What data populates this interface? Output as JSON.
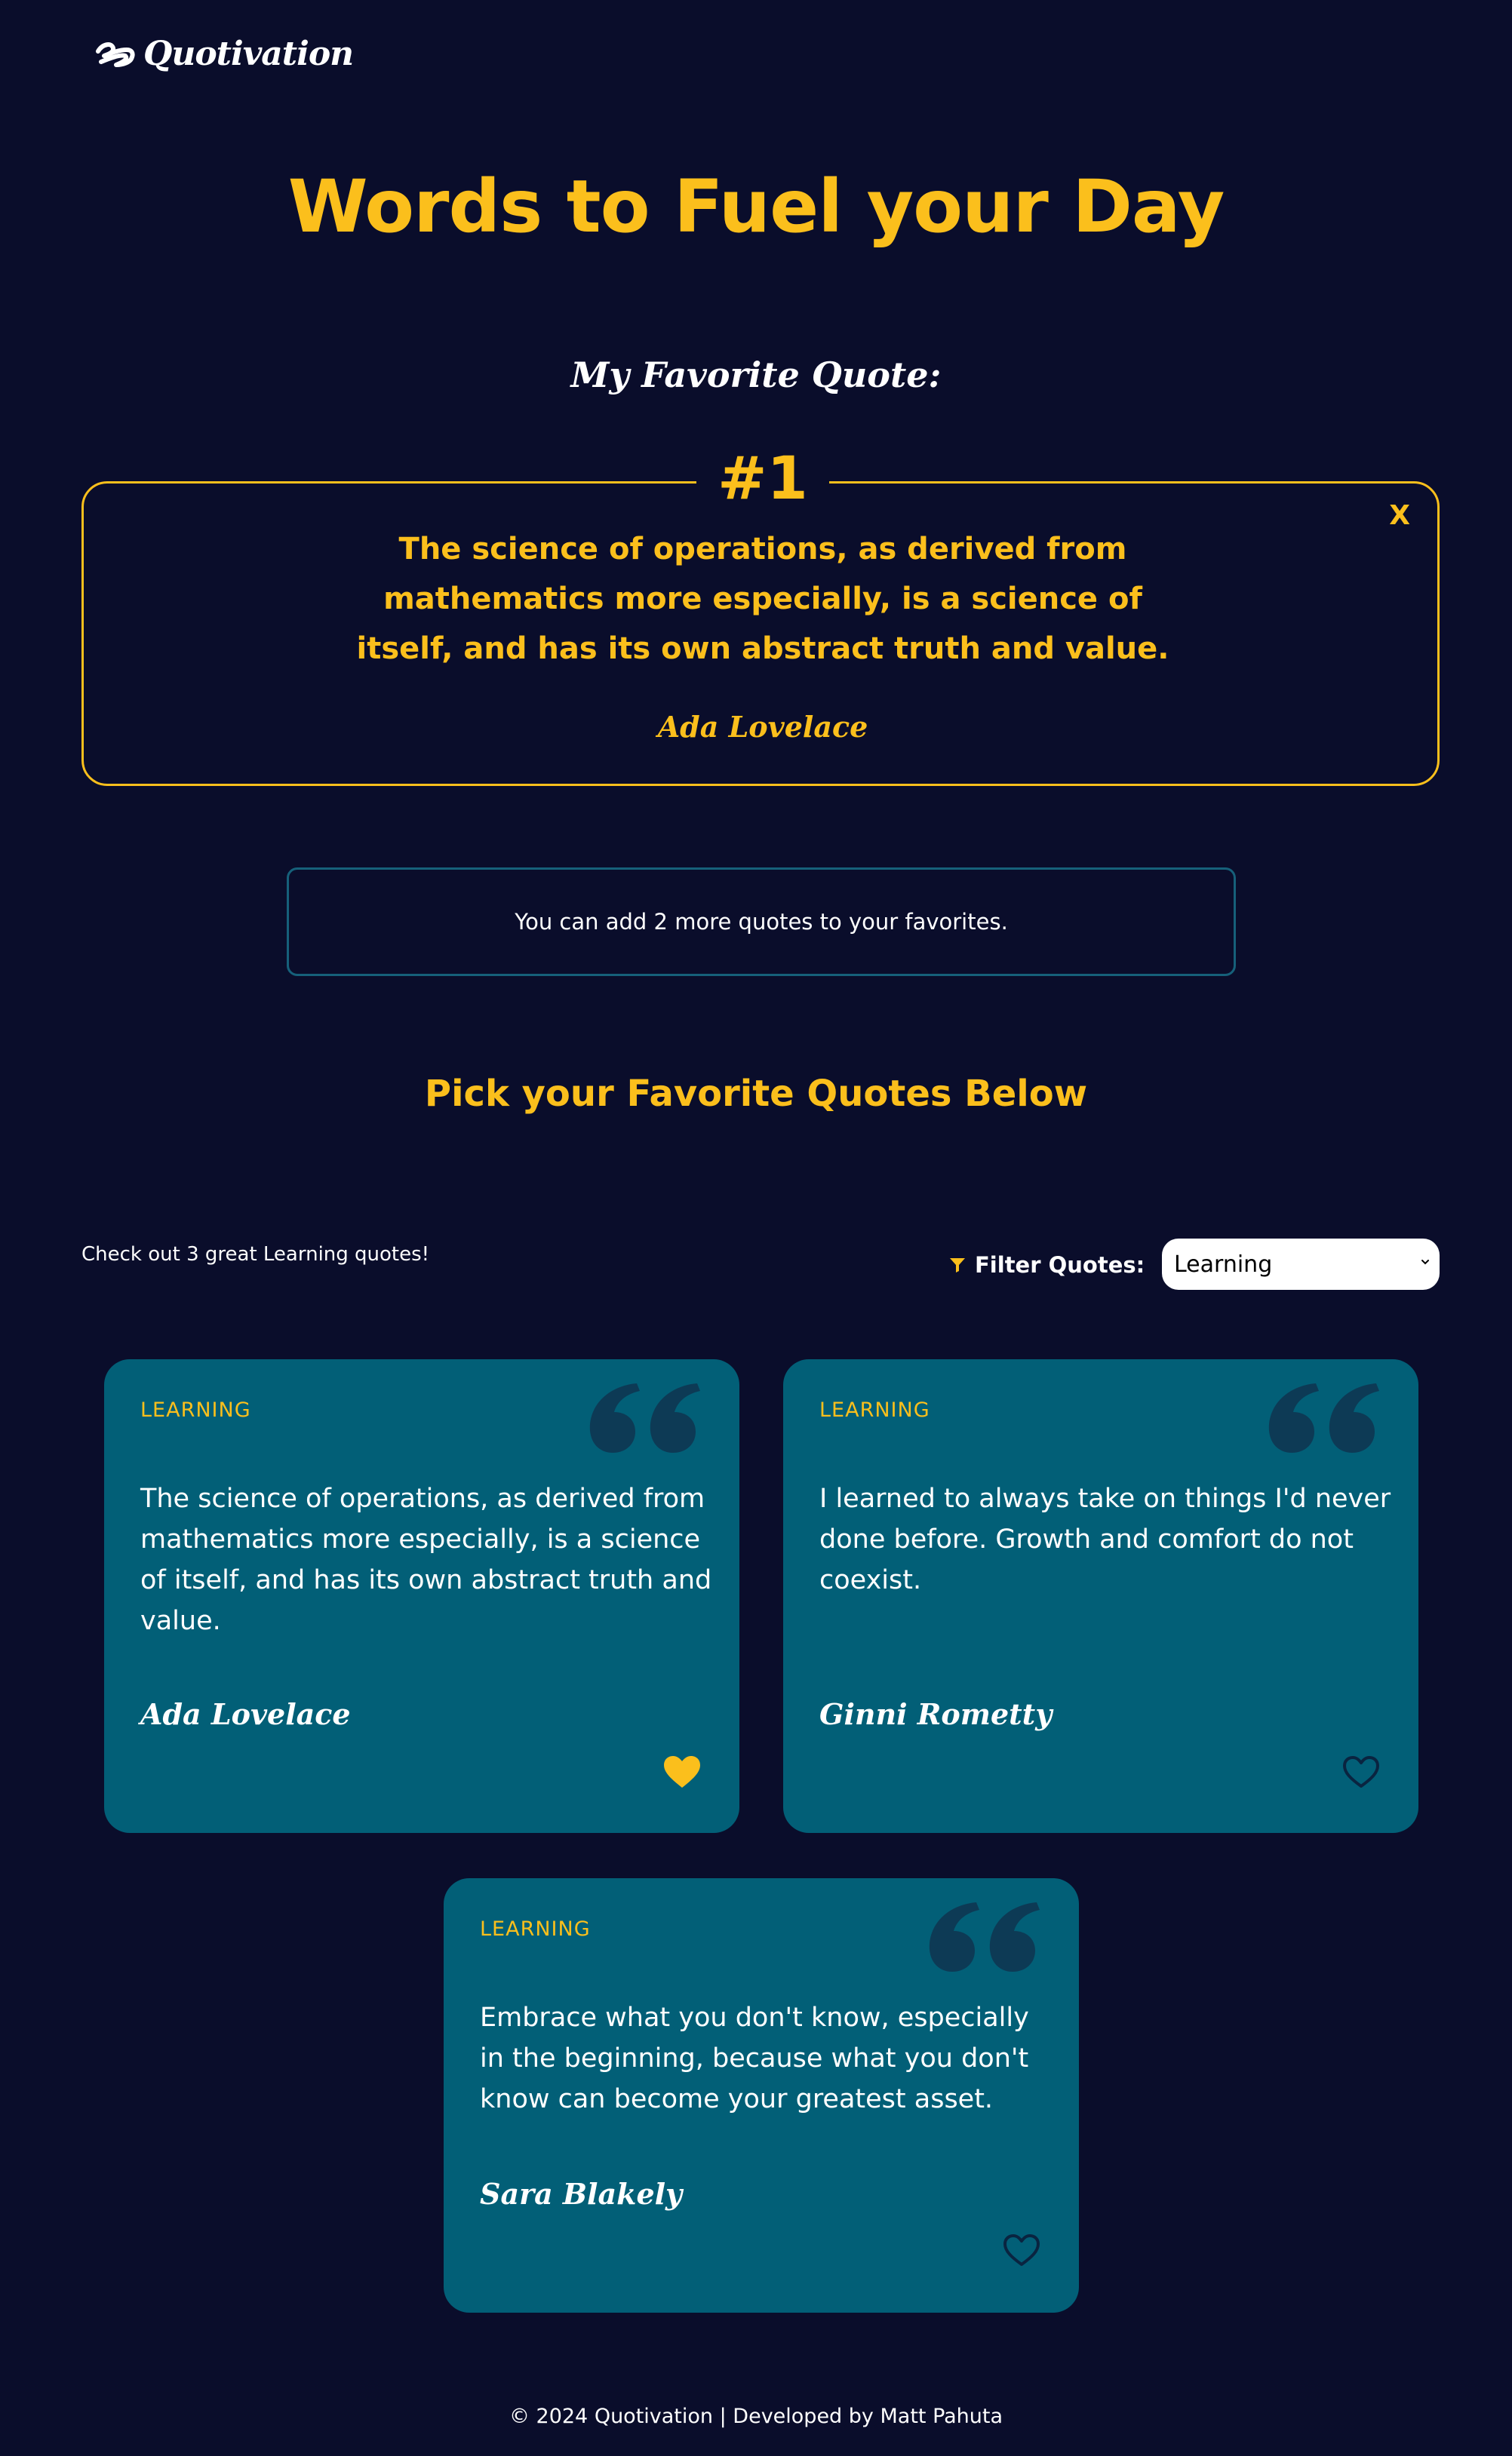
{
  "brand": {
    "name": "Quotivation"
  },
  "hero": {
    "title": "Words to Fuel your Day"
  },
  "favorites": {
    "heading": "My Favorite Quote:",
    "rank": "#1",
    "close_label": "X",
    "quote": "The science of operations, as derived from mathematics more especially, is a science of itself, and has its own abstract truth and value.",
    "author": "Ada Lovelace"
  },
  "notice": {
    "text": "You can add 2 more quotes to your favorites."
  },
  "pick": {
    "heading": "Pick your Favorite Quotes Below"
  },
  "filter": {
    "count_text": "Check out 3 great Learning quotes!",
    "label": "Filter Quotes:",
    "selected": "Learning"
  },
  "quotes": [
    {
      "category": "LEARNING",
      "text": "The science of operations, as derived from mathematics more especially, is a science of itself, and has its own abstract truth and value.",
      "author": "Ada Lovelace",
      "favorited": true
    },
    {
      "category": "LEARNING",
      "text": "I learned to always take on things I'd never done before. Growth and comfort do not coexist.",
      "author": "Ginni Rometty",
      "favorited": false
    },
    {
      "category": "LEARNING",
      "text": "Embrace what you don't know, especially in the beginning, because what you don't know can become your greatest asset.",
      "author": "Sara Blakely",
      "favorited": false
    }
  ],
  "footer": {
    "text": "© 2024 Quotivation | Developed by Matt Pahuta"
  },
  "colors": {
    "background": "#0a0d2b",
    "accent": "#fbbf1c",
    "card": "#025f77",
    "quote_mark": "#0d3a55",
    "notice_border": "#16607a"
  },
  "icons": {
    "logo": "logo-swoosh-icon",
    "filter": "filter-icon",
    "quote": "quote-mark-icon",
    "heart": "heart-icon",
    "close": "close-icon",
    "dropdown": "chevron-down-icon"
  }
}
